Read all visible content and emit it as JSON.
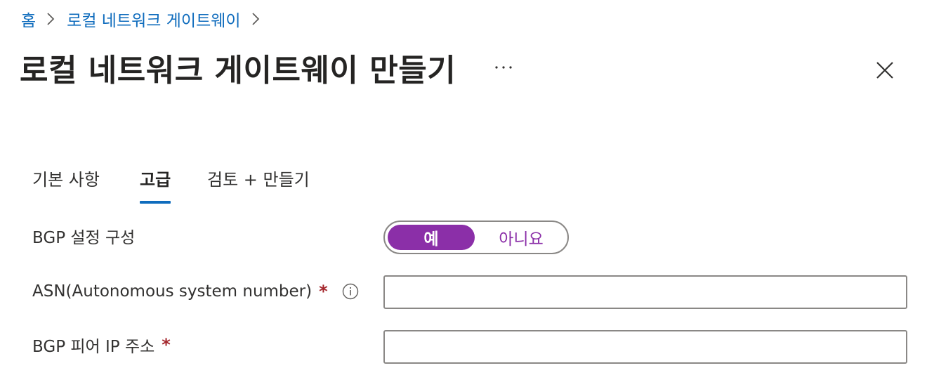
{
  "breadcrumb": {
    "home": "홈",
    "parent": "로컬 네트워크 게이트웨이"
  },
  "header": {
    "title": "로컬 네트워크 게이트웨이 만들기",
    "more_label": "···"
  },
  "tabs": [
    {
      "label": "기본 사항",
      "active": false
    },
    {
      "label": "고급",
      "active": true
    },
    {
      "label": "검토 + 만들기",
      "active": false
    }
  ],
  "form": {
    "bgp": {
      "label": "BGP 설정 구성",
      "options": [
        "예",
        "아니요"
      ],
      "selected": "예"
    },
    "asn": {
      "label": "ASN(Autonomous system number)",
      "required_mark": "*",
      "value": ""
    },
    "peer_ip": {
      "label": "BGP 피어 IP 주소",
      "required_mark": "*",
      "value": ""
    }
  },
  "colors": {
    "link": "#0f6cbd",
    "tab_underline": "#0f6cbd",
    "toggle_selected": "#8b2fa8",
    "required": "#a4262c"
  },
  "icons": {
    "breadcrumb_separator": "chevron-right-icon",
    "close": "close-icon",
    "more": "more-ellipsis-icon",
    "info": "info-icon"
  }
}
